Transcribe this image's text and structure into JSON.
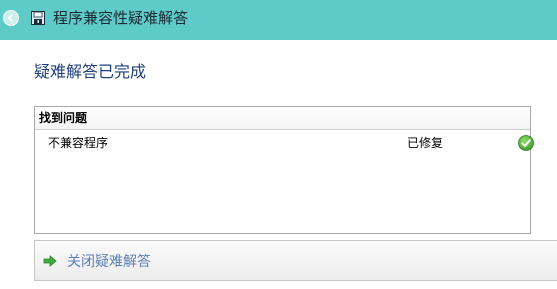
{
  "window": {
    "title": "程序兼容性疑难解答",
    "back_icon": "back-arrow-icon",
    "app_icon": "compatibility-troubleshooter-icon",
    "titlebar_color": "#5ecbc8"
  },
  "main": {
    "heading": "疑难解答已完成",
    "heading_color": "#1e3f7a"
  },
  "results": {
    "header": "找到问题",
    "rows": [
      {
        "issue": "不兼容程序",
        "status": "已修复",
        "status_icon": "green-check-icon"
      }
    ]
  },
  "actions": {
    "close_label": "关闭疑难解答",
    "close_icon": "green-arrow-icon",
    "link_color": "#5d7fb5"
  }
}
